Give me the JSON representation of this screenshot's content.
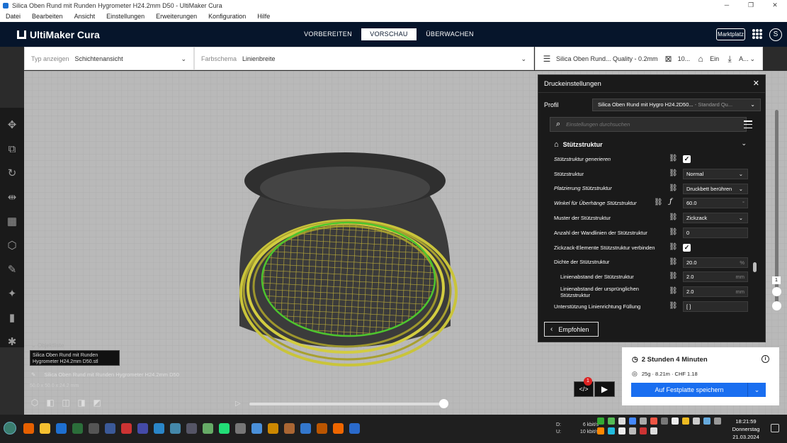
{
  "window": {
    "title": "Silica Oben Rund mit Runden Hygrometer H24.2mm D50 - UltiMaker Cura",
    "buttons": [
      "─",
      "❐",
      "✕"
    ]
  },
  "menubar": [
    "Datei",
    "Bearbeiten",
    "Ansicht",
    "Einstellungen",
    "Erweiterungen",
    "Konfiguration",
    "Hilfe"
  ],
  "header": {
    "logo": "UltiMaker Cura",
    "stages": [
      "VORBEREITEN",
      "VORSCHAU",
      "ÜBERWACHEN"
    ],
    "active_stage": "VORSCHAU",
    "marketplace": "Marktplatz",
    "account_initial": "S"
  },
  "toolbar": {
    "view_type_label": "Typ anzeigen",
    "view_type_value": "Schichtenansicht",
    "color_scheme_label": "Farbschema",
    "color_scheme_value": "Linienbreite",
    "print_profile": "Silica Oben Rund... Quality - 0.2mm",
    "infill": "10...",
    "support": "Ein",
    "adhesion": "A..."
  },
  "panel": {
    "title": "Druckeinstellungen",
    "profile_label": "Profil",
    "profile_value": "Silica Oben Rund mit Hygro H24.2D50...",
    "profile_sub": " - Standard Qu...",
    "search_placeholder": "Einstellungen durchsuchen",
    "category": "Stützstruktur",
    "settings": [
      {
        "label": "Stützstruktur generieren",
        "type": "checkbox",
        "value": "✓",
        "italic": true
      },
      {
        "label": "Stützstruktur",
        "type": "select",
        "value": "Normal"
      },
      {
        "label": "Platzierung Stützstruktur",
        "type": "select",
        "value": "Druckbett berühren",
        "italic": true
      },
      {
        "label": "Winkel für Überhänge Stützstruktur",
        "type": "input",
        "value": "60.0",
        "unit": "°",
        "italic": true,
        "fx": true
      },
      {
        "label": "Muster der Stützstruktur",
        "type": "select",
        "value": "Zickzack"
      },
      {
        "label": "Anzahl der Wandlinien der Stützstruktur",
        "type": "input",
        "value": "0",
        "unit": ""
      },
      {
        "label": "Zickzack-Elemente Stützstruktur verbinden",
        "type": "checkbox",
        "value": "✓"
      },
      {
        "label": "Dichte der Stützstruktur",
        "type": "input",
        "value": "20.0",
        "unit": "%"
      },
      {
        "label": "Linienabstand der Stützstruktur",
        "type": "input",
        "value": "2.0",
        "unit": "mm",
        "indent": true
      },
      {
        "label": "Linienabstand der ursprünglichen Stützstruktur",
        "type": "input",
        "value": "2.0",
        "unit": "mm",
        "indent": true
      },
      {
        "label": "Unterstützung Linienrichtung Füllung",
        "type": "input",
        "value": "[ ]",
        "unit": ""
      }
    ],
    "recommended_button": "Empfohlen"
  },
  "layer_slider": {
    "badge": "1"
  },
  "objects": {
    "toggle": "Objektliste",
    "tooltip": "Silica Oben Rund mit Runden Hygrometer H24.2mm D50.stl",
    "name": "Silica Oben Rund mit Runden Hygrometer H24.2mm D50",
    "dims": "50.0 x 50.0 x 24.2 mm"
  },
  "estimate": {
    "time": "2 Stunden 4 Minuten",
    "material": "25g · 8.21m · CHF 1.18",
    "save_button": "Auf Festplatte speichern",
    "notification_count": "1"
  },
  "taskbar": {
    "net_down_label": "D:",
    "net_down": "6 kbit/s",
    "net_up_label": "U:",
    "net_up": "10 kbit/s",
    "time": "18:21:59",
    "day": "Donnerstag",
    "date": "21.03.2024"
  },
  "colors": {
    "header_bg": "#06152b",
    "accent_blue": "#196ef0",
    "panel_bg": "#1a1a1a",
    "model_yellow": "#c9c43a",
    "model_green": "#4dc52e"
  }
}
